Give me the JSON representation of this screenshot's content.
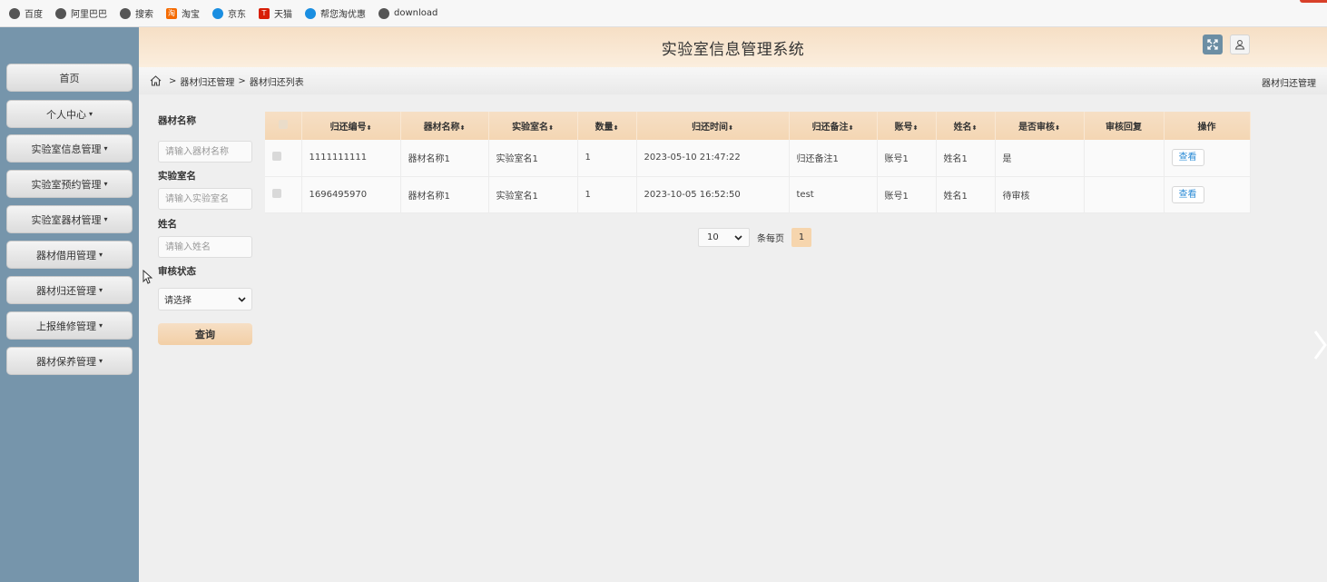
{
  "bookmarks": [
    {
      "label": "百度",
      "icon": "globe-icon"
    },
    {
      "label": "阿里巴巴",
      "icon": "globe-icon"
    },
    {
      "label": "搜索",
      "icon": "globe-icon"
    },
    {
      "label": "淘宝",
      "icon": "taobao-icon"
    },
    {
      "label": "京东",
      "icon": "jd-icon"
    },
    {
      "label": "天猫",
      "icon": "tmall-icon"
    },
    {
      "label": "帮您淘优惠",
      "icon": "help-icon"
    },
    {
      "label": "download",
      "icon": "globe-icon"
    }
  ],
  "sidebar": {
    "items": [
      {
        "label": "首页",
        "caret": ""
      },
      {
        "label": "个人中心",
        "caret": "▾"
      },
      {
        "label": "实验室信息管理",
        "caret": "▾"
      },
      {
        "label": "实验室预约管理",
        "caret": "▾"
      },
      {
        "label": "实验室器材管理",
        "caret": "▾"
      },
      {
        "label": "器材借用管理",
        "caret": "▾"
      },
      {
        "label": "器材归还管理",
        "caret": "▾"
      },
      {
        "label": "上报维修管理",
        "caret": "▾"
      },
      {
        "label": "器材保养管理",
        "caret": "▾"
      }
    ]
  },
  "header": {
    "title": "实验室信息管理系统"
  },
  "breadcrumb": {
    "sep": ">",
    "level1": "器材归还管理",
    "level2": "器材归还列表",
    "right": "器材归还管理"
  },
  "search": {
    "equipment_label": "器材名称",
    "equipment_placeholder": "请输入器材名称",
    "lab_label": "实验室名",
    "lab_placeholder": "请输入实验室名",
    "name_label": "姓名",
    "name_placeholder": "请输入姓名",
    "status_label": "审核状态",
    "status_value": "请选择",
    "query_label": "查询"
  },
  "table": {
    "sort_glyph": "⬍",
    "columns": [
      "归还编号",
      "器材名称",
      "实验室名",
      "数量",
      "归还时间",
      "归还备注",
      "账号",
      "姓名",
      "是否审核",
      "审核回复",
      "操作"
    ],
    "rows": [
      {
        "no": "1111111111",
        "equipment": "器材名称1",
        "lab": "实验室名1",
        "qty": "1",
        "time": "2023-05-10 21:47:22",
        "remark": "归还备注1",
        "account": "账号1",
        "name": "姓名1",
        "audit": "是",
        "reply": "",
        "action": "查看"
      },
      {
        "no": "1696495970",
        "equipment": "器材名称1",
        "lab": "实验室名1",
        "qty": "1",
        "time": "2023-10-05 16:52:50",
        "remark": "test",
        "account": "账号1",
        "name": "姓名1",
        "audit": "待审核",
        "reply": "",
        "action": "查看"
      }
    ]
  },
  "pager": {
    "page_size": "10",
    "per_page_label": "条每页",
    "current_page": "1"
  },
  "colors": {
    "sidebar": "#7695ab",
    "header": "#f6dfc5",
    "accent": "#f6d5ad",
    "link": "#2d8cd6"
  }
}
